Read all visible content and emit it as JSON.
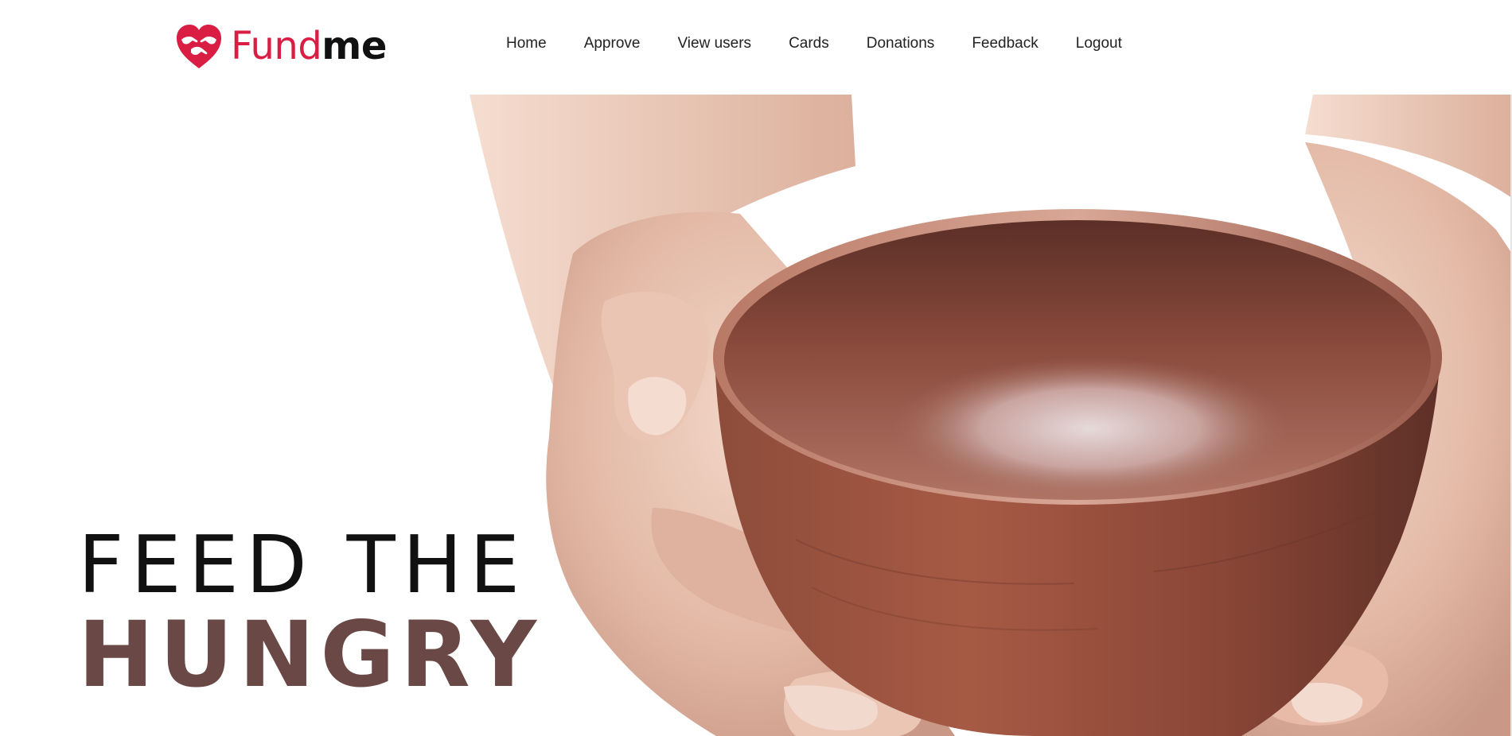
{
  "brand": {
    "name_part1": "Fund",
    "name_part2": "me",
    "logo_icon": "heart-hands-icon",
    "primary_color": "#d91d43",
    "text_color": "#111111"
  },
  "nav": {
    "items": [
      {
        "label": "Home"
      },
      {
        "label": "Approve"
      },
      {
        "label": "View users"
      },
      {
        "label": "Cards"
      },
      {
        "label": "Donations"
      },
      {
        "label": "Feedback"
      },
      {
        "label": "Logout"
      }
    ]
  },
  "hero": {
    "line1": "FEED THE",
    "line2": "HUNGRY",
    "line2_color": "#6a4845",
    "image": "hands-holding-empty-wooden-bowl"
  }
}
